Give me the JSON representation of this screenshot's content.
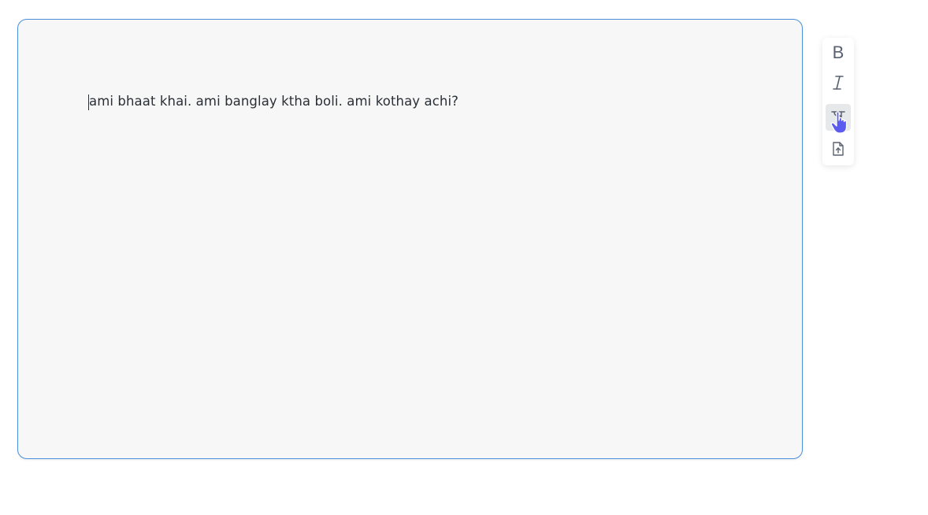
{
  "editor": {
    "content": "ami bhaat khai. ami banglay ktha boli. ami kothay achi?"
  },
  "toolbar": {
    "bold_label": "B",
    "buttons": [
      {
        "icon": "bold-icon",
        "active": false
      },
      {
        "icon": "italic-icon",
        "active": false
      },
      {
        "icon": "bengali-script-icon",
        "active": true
      },
      {
        "icon": "file-upload-icon",
        "active": false
      }
    ]
  },
  "colors": {
    "editor_border": "#4a8fd9",
    "editor_background": "#f7f7f7",
    "text": "#2b2f36",
    "icon": "#5a6170",
    "active_button_background": "#e7e8ea",
    "cursor_hand": "#5b5bf0"
  }
}
